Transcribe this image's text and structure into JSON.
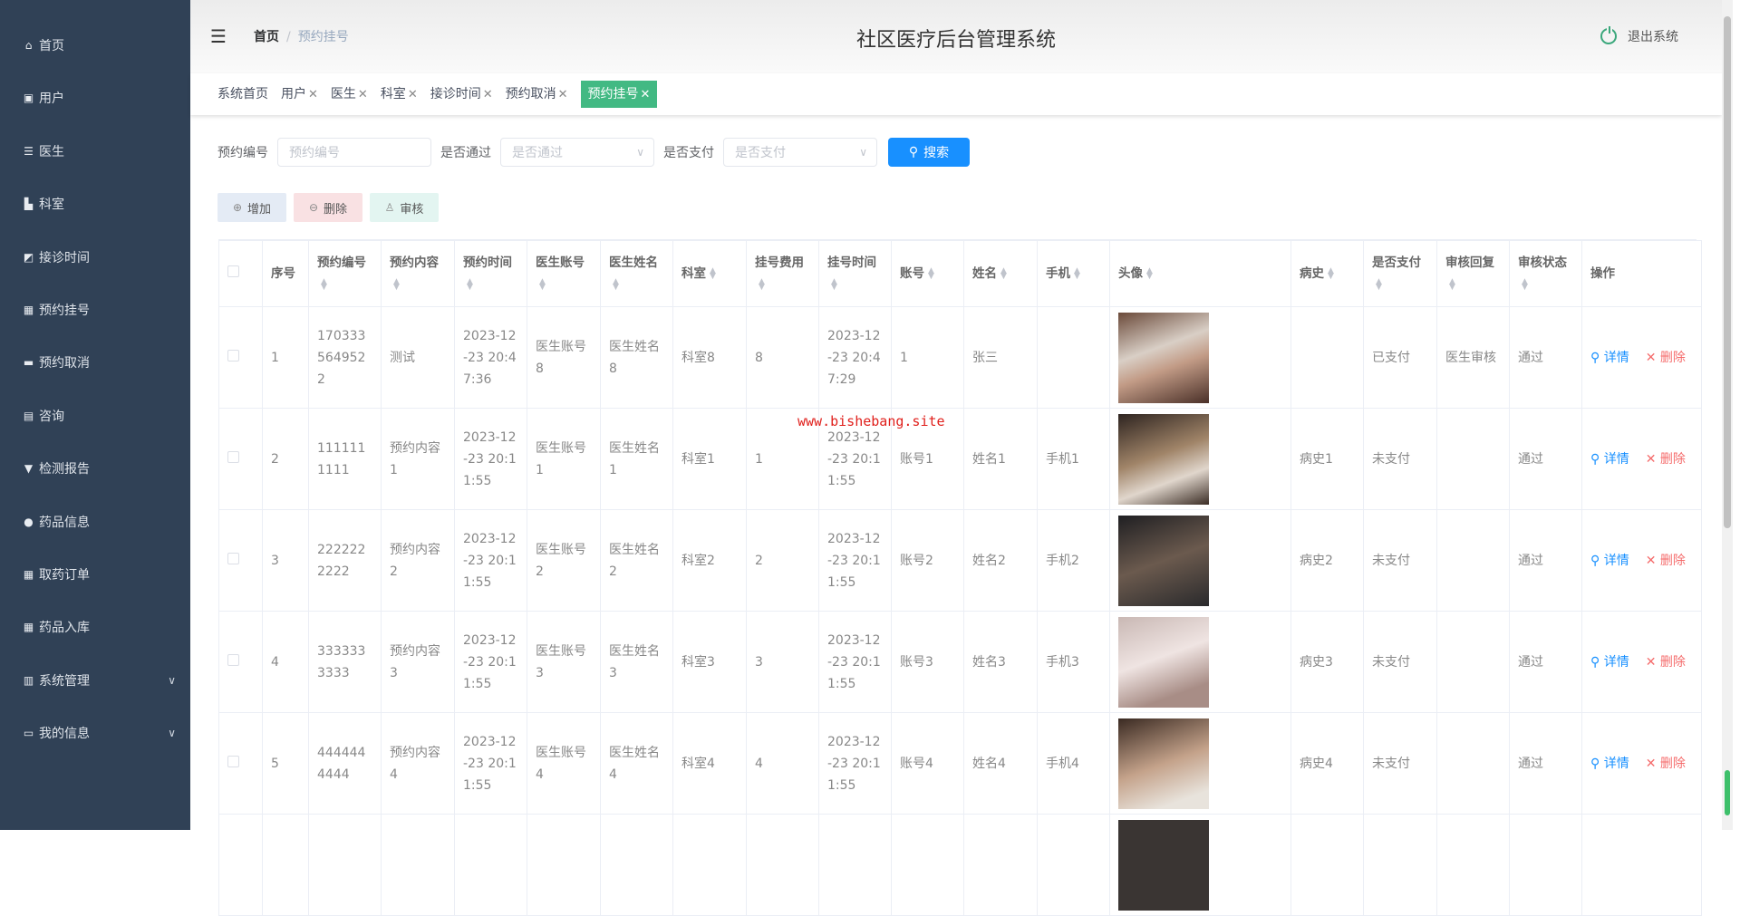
{
  "sidebar": {
    "items": [
      {
        "label": "首页",
        "icon": "home-icon"
      },
      {
        "label": "用户",
        "icon": "clipboard-icon"
      },
      {
        "label": "医生",
        "icon": "list-icon"
      },
      {
        "label": "科室",
        "icon": "folder-icon"
      },
      {
        "label": "接诊时间",
        "icon": "chart-icon"
      },
      {
        "label": "预约挂号",
        "icon": "grid-icon"
      },
      {
        "label": "预约取消",
        "icon": "ticket-icon"
      },
      {
        "label": "咨询",
        "icon": "book-icon"
      },
      {
        "label": "检测报告",
        "icon": "pin-icon"
      },
      {
        "label": "药品信息",
        "icon": "user-icon"
      },
      {
        "label": "取药订单",
        "icon": "grid-icon"
      },
      {
        "label": "药品入库",
        "icon": "grid-icon"
      },
      {
        "label": "系统管理",
        "icon": "bar-chart-icon",
        "expandable": true
      },
      {
        "label": "我的信息",
        "icon": "id-card-icon",
        "expandable": true
      }
    ]
  },
  "header": {
    "breadcrumb_home": "首页",
    "breadcrumb_current": "预约挂号",
    "title": "社区医疗后台管理系统",
    "logout": "退出系统"
  },
  "tabs": [
    {
      "label": "系统首页",
      "closable": false
    },
    {
      "label": "用户",
      "closable": true
    },
    {
      "label": "医生",
      "closable": true
    },
    {
      "label": "科室",
      "closable": true
    },
    {
      "label": "接诊时间",
      "closable": true
    },
    {
      "label": "预约取消",
      "closable": true
    },
    {
      "label": "预约挂号",
      "closable": true,
      "active": true
    }
  ],
  "search": {
    "no_label": "预约编号",
    "no_placeholder": "预约编号",
    "pass_label": "是否通过",
    "pass_placeholder": "是否通过",
    "pay_label": "是否支付",
    "pay_placeholder": "是否支付",
    "button": "搜索"
  },
  "actions": {
    "add": "增加",
    "delete": "删除",
    "review": "审核"
  },
  "table": {
    "columns": [
      "序号",
      "预约编号",
      "预约内容",
      "预约时间",
      "医生账号",
      "医生姓名",
      "科室",
      "挂号费用",
      "挂号时间",
      "账号",
      "姓名",
      "手机",
      "头像",
      "病史",
      "是否支付",
      "审核回复",
      "审核状态",
      "操作"
    ],
    "detail_label": "详情",
    "delete_label": "删除",
    "rows": [
      [
        "1",
        "1703335649522",
        "测试",
        "2023-12-23 20:47:36",
        "医生账号8",
        "医生姓名8",
        "科室8",
        "8",
        "2023-12-23 20:47:29",
        "1",
        "张三",
        "",
        "",
        "已支付",
        "医生审核",
        "通过"
      ],
      [
        "2",
        "1111111111",
        "预约内容1",
        "2023-12-23 20:11:55",
        "医生账号1",
        "医生姓名1",
        "科室1",
        "1",
        "2023-12-23 20:11:55",
        "账号1",
        "姓名1",
        "手机1",
        "病史1",
        "未支付",
        "",
        "通过"
      ],
      [
        "3",
        "2222222222",
        "预约内容2",
        "2023-12-23 20:11:55",
        "医生账号2",
        "医生姓名2",
        "科室2",
        "2",
        "2023-12-23 20:11:55",
        "账号2",
        "姓名2",
        "手机2",
        "病史2",
        "未支付",
        "",
        "通过"
      ],
      [
        "4",
        "3333333333",
        "预约内容3",
        "2023-12-23 20:11:55",
        "医生账号3",
        "医生姓名3",
        "科室3",
        "3",
        "2023-12-23 20:11:55",
        "账号3",
        "姓名3",
        "手机3",
        "病史3",
        "未支付",
        "",
        "通过"
      ],
      [
        "5",
        "4444444444",
        "预约内容4",
        "2023-12-23 20:11:55",
        "医生账号4",
        "医生姓名4",
        "科室4",
        "4",
        "2023-12-23 20:11:55",
        "账号4",
        "姓名4",
        "手机4",
        "病史4",
        "未支付",
        "",
        "通过"
      ]
    ]
  },
  "watermark": "www.bishebang.site",
  "colors": {
    "sidebar": "#304156",
    "active_tab": "#42b983",
    "primary": "#1890ff",
    "danger": "#f56c6c"
  }
}
